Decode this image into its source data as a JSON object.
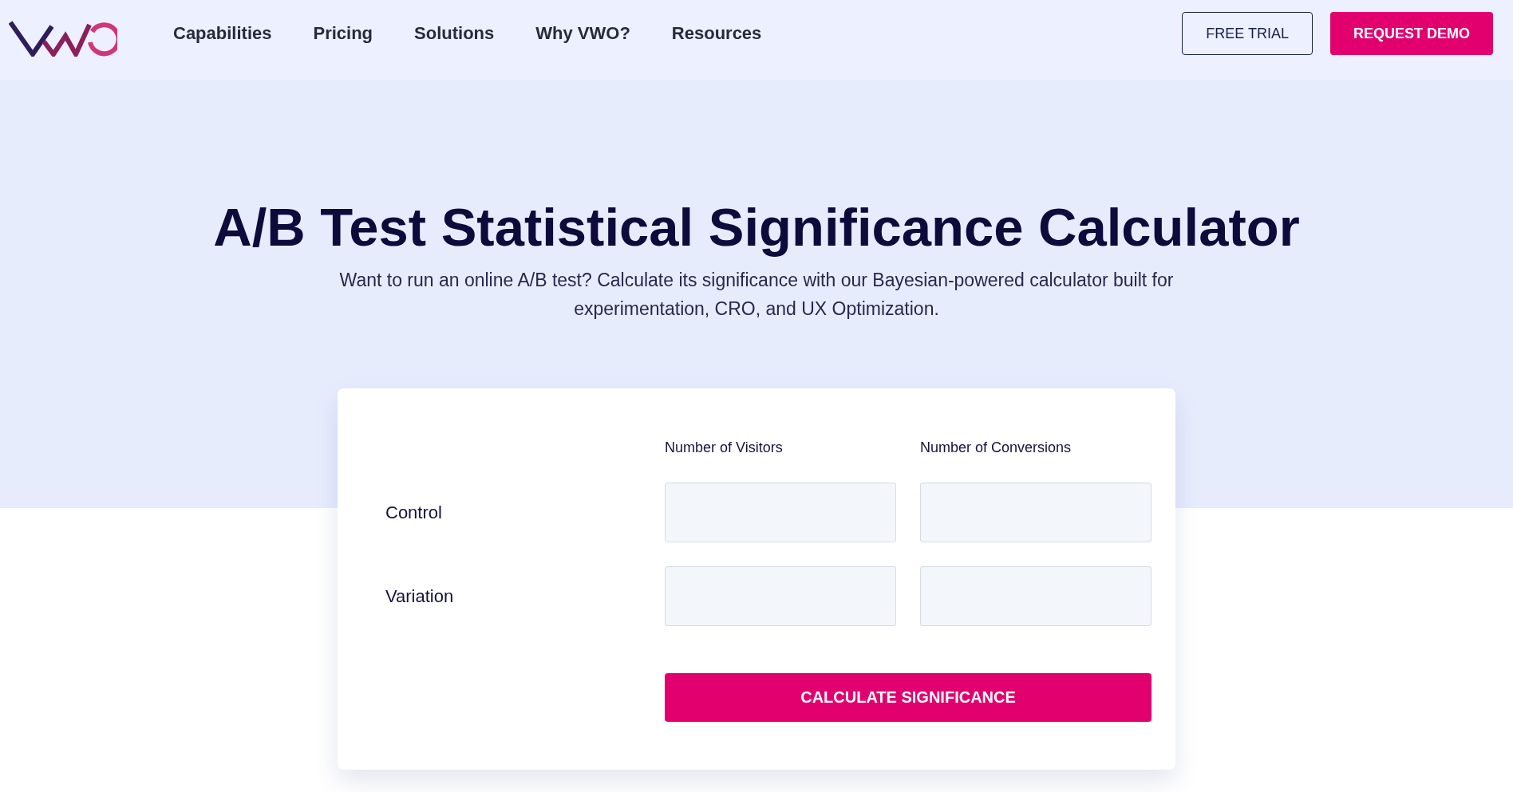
{
  "header": {
    "nav": [
      "Capabilities",
      "Pricing",
      "Solutions",
      "Why VWO?",
      "Resources"
    ],
    "buttons": [
      {
        "label": "FREE TRIAL",
        "kind": "outline"
      },
      {
        "label": "REQUEST DEMO",
        "kind": "filled"
      }
    ]
  },
  "hero": {
    "title": "A/B Test Statistical Significance Calculator",
    "subtitle": "Want to run an online A/B test? Calculate its significance with our Bayesian-powered calculator built for experimentation, CRO, and UX Optimization."
  },
  "calculator": {
    "columns": [
      "Number of Visitors",
      "Number of Conversions"
    ],
    "rows": [
      {
        "label": "Control"
      },
      {
        "label": "Variation"
      }
    ],
    "button": "CALCULATE SIGNIFICANCE"
  }
}
